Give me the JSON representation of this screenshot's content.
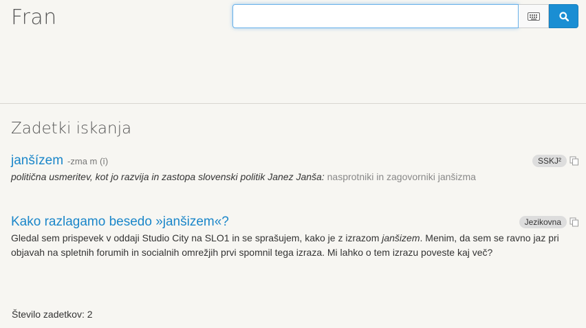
{
  "app": {
    "logo": "Fran"
  },
  "search": {
    "value": "",
    "placeholder": ""
  },
  "results_title": "Zadetki iskanja",
  "results": [
    {
      "headword": "janšízem",
      "grammar": "-zma m (ī)",
      "source": "SSKJ²",
      "definition": "politična usmeritev, kot jo razvija in zastopa slovenski politik Janez Janša:",
      "example": "nasprotniki in zagovorniki janšizma"
    },
    {
      "title": "Kako razlagamo besedo »janšizem«?",
      "source": "Jezikovna",
      "text_before": "Gledal sem prispevek v oddaji Studio City na SLO1 in se sprašujem, kako je z izrazom ",
      "text_italic": "janšizem",
      "text_after": ". Menim, da sem se ravno jaz pri objavah na spletnih forumih in socialnih omrežjih prvi spomnil tega izraza. Mi lahko o tem izrazu poveste kaj več?"
    }
  ],
  "count_label": "Število zadetkov: 2",
  "colors": {
    "accent": "#1a8ed3",
    "link": "#1a86c9"
  },
  "icons": {
    "keyboard": "keyboard-icon",
    "search": "search-icon",
    "copy": "copy-icon"
  }
}
